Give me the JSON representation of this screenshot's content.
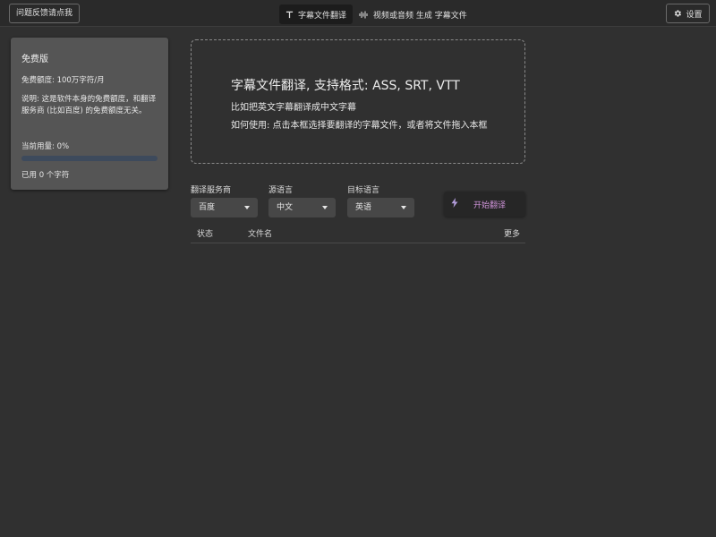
{
  "header": {
    "feedback_label": "问题反馈请点我",
    "tabs": [
      {
        "icon": "text-icon",
        "label": "字幕文件翻译",
        "active": true
      },
      {
        "icon": "waveform-icon",
        "label": "视频或音频 生成 字幕文件",
        "active": false
      }
    ],
    "settings_label": "设置"
  },
  "sidebar": {
    "title": "免费版",
    "quota": "免费额度: 100万字符/月",
    "description": "说明: 这是软件本身的免费额度，和翻译服务商 (比如百度) 的免费额度无关。",
    "usage_label": "当前用量: 0%",
    "usage_fraction": 0,
    "used_chars": "已用 0 个字符"
  },
  "dropzone": {
    "title": "字幕文件翻译, 支持格式: ASS, SRT, VTT",
    "line1": "比如把英文字幕翻译成中文字幕",
    "line2": "如何使用: 点击本框选择要翻译的字幕文件，或者将文件拖入本框"
  },
  "options": {
    "provider": {
      "label": "翻译服务商",
      "value": "百度"
    },
    "source": {
      "label": "源语言",
      "value": "中文"
    },
    "target": {
      "label": "目标语言",
      "value": "英语"
    },
    "start_label": "开始翻译"
  },
  "table": {
    "columns": [
      "状态",
      "文件名",
      "更多"
    ]
  },
  "colors": {
    "background": "#303030",
    "accent_purple": "#ce93d8",
    "progress_track": "#3d4a5c"
  }
}
